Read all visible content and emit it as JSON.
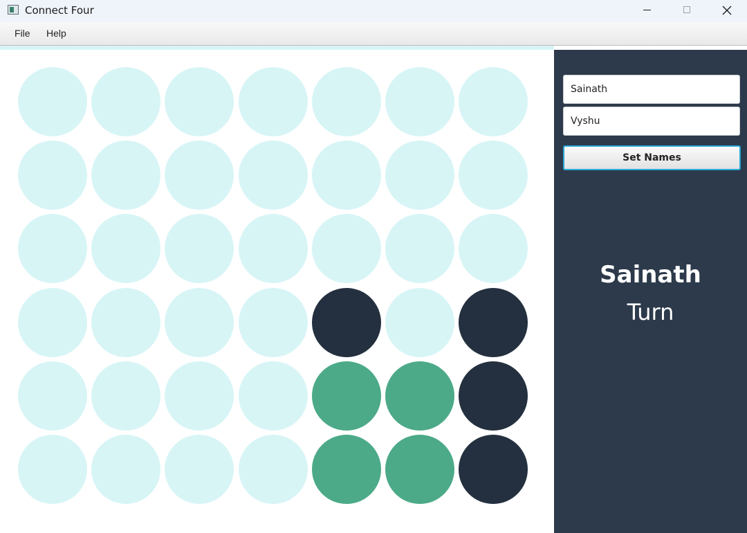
{
  "window": {
    "title": "Connect Four",
    "icon": "app-window-icon",
    "controls": [
      "minimize-icon",
      "maximize-icon",
      "close-icon"
    ]
  },
  "menu": {
    "items": [
      "File",
      "Help"
    ]
  },
  "colors": {
    "empty": "#d8f5f6",
    "player1_disc": "#24303f",
    "player2_disc": "#4caa88",
    "sidebar_bg": "#2c3a4b",
    "button_focus": "#2aa7d6"
  },
  "board": {
    "columns": 7,
    "rows": 6,
    "cells": [
      [
        "empty",
        "empty",
        "empty",
        "empty",
        "empty",
        "empty",
        "empty"
      ],
      [
        "empty",
        "empty",
        "empty",
        "empty",
        "empty",
        "empty",
        "empty"
      ],
      [
        "empty",
        "empty",
        "empty",
        "empty",
        "empty",
        "empty",
        "empty"
      ],
      [
        "empty",
        "empty",
        "empty",
        "empty",
        "player1_disc",
        "empty",
        "player1_disc"
      ],
      [
        "empty",
        "empty",
        "empty",
        "empty",
        "player2_disc",
        "player2_disc",
        "player1_disc"
      ],
      [
        "empty",
        "empty",
        "empty",
        "empty",
        "player2_disc",
        "player2_disc",
        "player1_disc"
      ]
    ]
  },
  "sidebar": {
    "player1_name": "Sainath",
    "player2_name": "Vyshu",
    "set_names_label": "Set Names",
    "current_player": "Sainath",
    "turn_label": "Turn"
  }
}
